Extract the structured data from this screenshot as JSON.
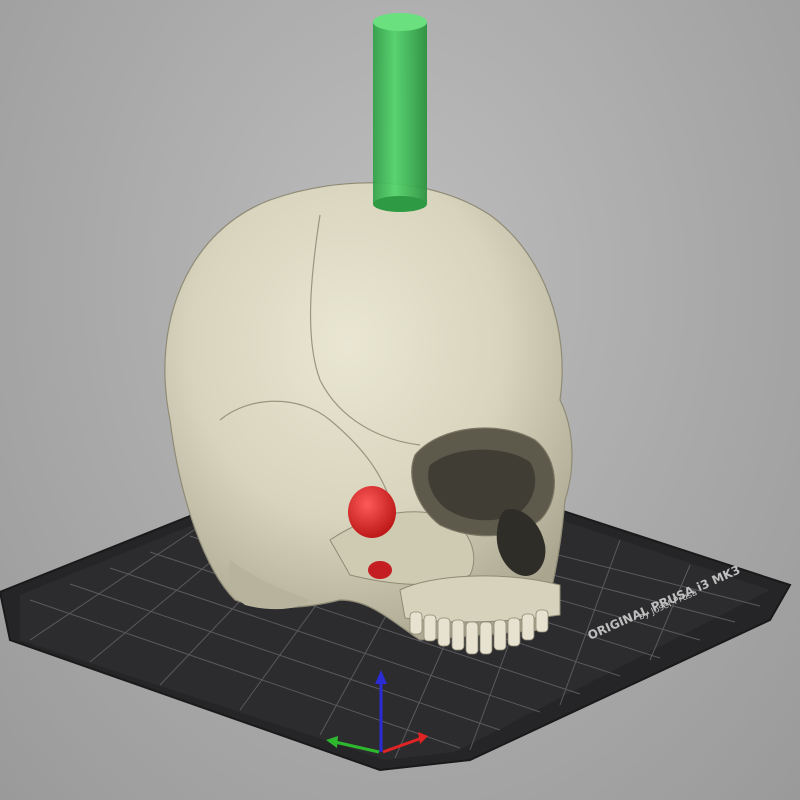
{
  "viewport": {
    "background": "#a9a9a9"
  },
  "bed": {
    "label_line1": "ORIGINAL PRUSA i3 MK3",
    "label_line2": "by Josef Prusa",
    "surface_color": "#2c2c2e",
    "grid_color": "#5a5a5e"
  },
  "model": {
    "color": "#d8d4bd",
    "support_marker_color": "#d9262a",
    "cylinder_color": "#3fc15a"
  },
  "axes": {
    "x_color": "#e02424",
    "y_color": "#2eb82e",
    "z_color": "#2b2bd6"
  }
}
